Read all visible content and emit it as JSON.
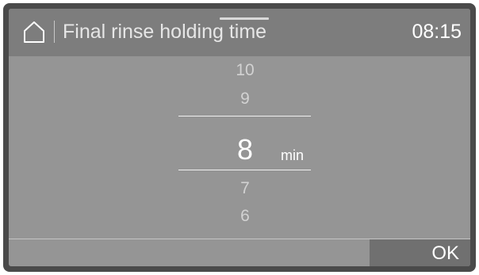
{
  "header": {
    "home_icon": "home-icon",
    "title": "Final rinse holding time",
    "time": "08:15"
  },
  "picker": {
    "above": [
      "10",
      "9"
    ],
    "selected": "8",
    "unit": "min",
    "below": [
      "7",
      "6"
    ]
  },
  "footer": {
    "ok_label": "OK"
  },
  "colors": {
    "bezel": "#4a4a4a",
    "screen": "#959595",
    "header": "#7d7d7d",
    "ok_button": "#707070",
    "text": "#ffffff"
  }
}
